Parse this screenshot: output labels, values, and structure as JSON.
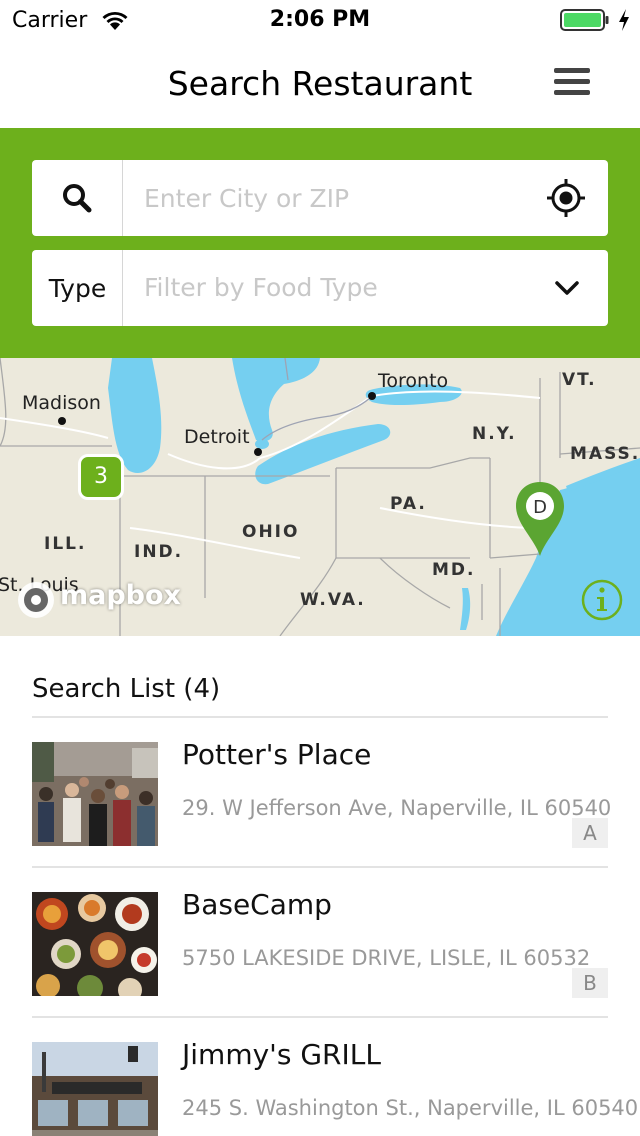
{
  "status_bar": {
    "carrier": "Carrier",
    "time": "2:06 PM",
    "battery_color": "#4cd964"
  },
  "nav": {
    "title": "Search Restaurant",
    "menu_icon": "hamburger-menu-icon"
  },
  "filter": {
    "background": "#6db01c",
    "city": {
      "icon": "search-icon",
      "placeholder": "Enter City or ZIP",
      "value": "",
      "locate_icon": "crosshair-locate-icon"
    },
    "type": {
      "label": "Type",
      "placeholder": "Filter by Food Type",
      "dropdown_icon": "chevron-down-icon"
    }
  },
  "map": {
    "cities": [
      "Madison",
      "Detroit",
      "Toronto",
      "St. Louis"
    ],
    "states": [
      "VT.",
      "N.Y.",
      "MASS.",
      "PA.",
      "OHIO",
      "ILL.",
      "IND.",
      "MD.",
      "W.VA."
    ],
    "cluster": {
      "count": "3",
      "color": "#6db01c"
    },
    "pin": {
      "letter": "D",
      "color": "#5ba532"
    },
    "attribution": "mapbox",
    "info_icon": "info-icon"
  },
  "list": {
    "title": "Search List (4)",
    "items": [
      {
        "name": "Potter's Place",
        "address": "29. W Jefferson Ave, Naperville, IL 60540",
        "badge": "A"
      },
      {
        "name": "BaseCamp",
        "address": "5750 LAKESIDE DRIVE, LISLE, IL 60532",
        "badge": "B"
      },
      {
        "name": "Jimmy's GRILL",
        "address": "245 S. Washington St., Naperville, IL 60540",
        "badge": ""
      }
    ]
  }
}
